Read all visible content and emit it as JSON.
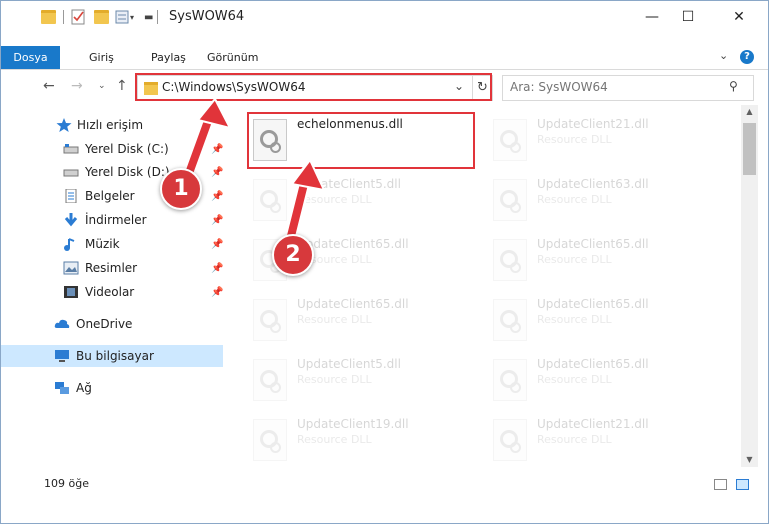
{
  "window": {
    "title": "SysWOW64",
    "controls": {
      "minimize": "—",
      "maximize": "☐",
      "close": "✕"
    }
  },
  "ribbon": {
    "tabs": [
      "Dosya",
      "Giriş",
      "Paylaş",
      "Görünüm"
    ],
    "expand_icon": "chevron-down-icon",
    "help_label": "?"
  },
  "nav": {
    "address_path": "C:\\Windows\\SysWOW64",
    "search_placeholder": "Ara: SysWOW64"
  },
  "sidebar": {
    "items": [
      {
        "label": "Hızlı erişim",
        "icon": "star-icon",
        "pinned": false
      },
      {
        "label": "Yerel Disk (C:)",
        "icon": "drive-icon",
        "pinned": true
      },
      {
        "label": "Yerel Disk (D:)",
        "icon": "drive-icon",
        "pinned": true
      },
      {
        "label": "Belgeler",
        "icon": "documents-icon",
        "pinned": true
      },
      {
        "label": "İndirmeler",
        "icon": "download-icon",
        "pinned": true
      },
      {
        "label": "Müzik",
        "icon": "music-icon",
        "pinned": true
      },
      {
        "label": "Resimler",
        "icon": "pictures-icon",
        "pinned": true
      },
      {
        "label": "Videolar",
        "icon": "videos-icon",
        "pinned": true
      },
      {
        "label": "OneDrive",
        "icon": "cloud-icon",
        "pinned": false
      },
      {
        "label": "Bu bilgisayar",
        "icon": "computer-icon",
        "pinned": false,
        "selected": true
      },
      {
        "label": "Ağ",
        "icon": "network-icon",
        "pinned": false
      }
    ]
  },
  "files": {
    "main": {
      "name": "echelonmenus.dll"
    },
    "ghost": [
      {
        "name": "UpdateClient21.dll",
        "type": "Resource DLL"
      },
      {
        "name": "UpdateClient5.dll",
        "type": "Resource DLL"
      },
      {
        "name": "UpdateClient63.dll",
        "type": "Resource DLL"
      },
      {
        "name": "UpdateClient65.dll",
        "type": "Resource DLL"
      },
      {
        "name": "UpdateClient65.dll",
        "type": "Resource DLL"
      },
      {
        "name": "UpdateClient65.dll",
        "type": "Resource DLL"
      },
      {
        "name": "UpdateClient65.dll",
        "type": "Resource DLL"
      },
      {
        "name": "UpdateClient5.dll",
        "type": "Resource DLL"
      },
      {
        "name": "UpdateClient65.dll",
        "type": "Resource DLL"
      },
      {
        "name": "UpdateClient19.dll",
        "type": "Resource DLL"
      },
      {
        "name": "UpdateClient21.dll",
        "type": "Resource DLL"
      }
    ]
  },
  "status": {
    "item_count": "109 öğe"
  },
  "annotations": {
    "step1": "1",
    "step2": "2",
    "color": "#e1343a"
  }
}
